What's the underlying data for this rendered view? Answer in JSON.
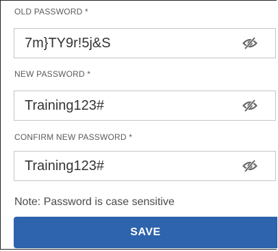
{
  "form": {
    "old_password": {
      "label": "OLD PASSWORD *",
      "value": "7m}TY9r!5j&S"
    },
    "new_password": {
      "label": "NEW PASSWORD *",
      "value": "Training123#"
    },
    "confirm_password": {
      "label": "CONFIRM NEW PASSWORD *",
      "value": "Training123#"
    },
    "note": "Note: Password is case sensitive",
    "save_label": "SAVE"
  },
  "icons": {
    "visibility_toggle": "eye-slash-icon"
  },
  "colors": {
    "primary_button": "#2e63ad",
    "input_border": "#c4c4c4",
    "label_text": "#5a5a5a"
  }
}
